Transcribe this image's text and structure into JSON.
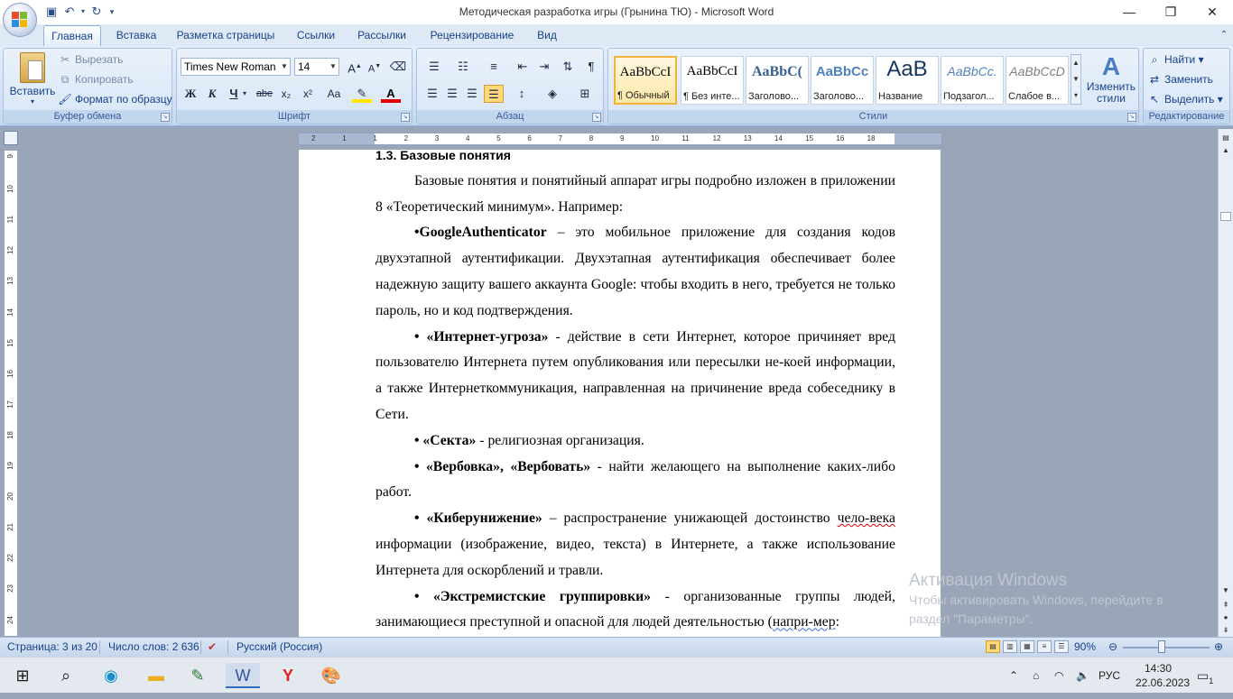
{
  "window": {
    "title": "Методическая разработка игры (Грынина ТЮ) - Microsoft Word"
  },
  "qat": {
    "icons": [
      "save-icon",
      "undo-icon",
      "redo-icon",
      "customize-icon"
    ]
  },
  "tabs": [
    "Главная",
    "Вставка",
    "Разметка страницы",
    "Ссылки",
    "Рассылки",
    "Рецензирование",
    "Вид"
  ],
  "clipboard": {
    "paste": "Вставить",
    "cut": "Вырезать",
    "copy": "Копировать",
    "format": "Формат по образцу",
    "label": "Буфер обмена"
  },
  "font": {
    "name": "Times New Roman",
    "size": "14",
    "label": "Шрифт",
    "bold": "Ж",
    "italic": "К",
    "underline": "Ч",
    "strike": "abe",
    "sub": "x₂",
    "sup": "x²",
    "case": "Aa"
  },
  "paragraph": {
    "label": "Абзац"
  },
  "styles": {
    "label": "Стили",
    "change": "Изменить стили",
    "items": [
      {
        "sample": "AaBbCcI",
        "name": "¶ Обычный"
      },
      {
        "sample": "AaBbCcI",
        "name": "¶ Без инте..."
      },
      {
        "sample": "AaBbC(",
        "name": "Заголово..."
      },
      {
        "sample": "AaBbCc",
        "name": "Заголово..."
      },
      {
        "sample": "AaB",
        "name": "Название"
      },
      {
        "sample": "AaBbCc.",
        "name": "Подзагол..."
      },
      {
        "sample": "AaBbCcD",
        "name": "Слабое в..."
      }
    ]
  },
  "editing": {
    "find": "Найти",
    "replace": "Заменить",
    "select": "Выделить",
    "label": "Редактирование"
  },
  "ruler": {
    "h": [
      "2",
      "1",
      "1",
      "2",
      "3",
      "4",
      "5",
      "6",
      "7",
      "8",
      "9",
      "10",
      "11",
      "12",
      "13",
      "14",
      "15",
      "16",
      "18"
    ],
    "v": [
      "9",
      "10",
      "11",
      "12",
      "13",
      "14",
      "15",
      "16",
      "17",
      "18",
      "19",
      "20",
      "21",
      "22",
      "23",
      "24"
    ]
  },
  "doc": {
    "heading": "1.3.    Базовые понятия",
    "p1": "Базовые понятия и понятийный аппарат игры подробно изложен в приложении 8 «Теоретический минимум». Например:",
    "p2b": "•GoogleAuthenticator",
    "p2": " – это мобильное приложение для создания кодов двухэтапной аутентификации. Двухэтапная аутентификация обеспечивает более надежную защиту вашего аккаунта Google: чтобы входить в него, требуется не только пароль, но и код подтверждения.",
    "p3b": "• «Интернет-угроза»",
    "p3": " - действие в сети Интернет, которое причиняет вред пользователю Интернета путем опубликования или пересылки не-коей информации, а также Интернеткоммуникация, направленная на причинение вреда собеседнику в Сети.",
    "p4b": "• «Секта»",
    "p4": " - религиозная организация.",
    "p5b": "• «Вербовка», «Вербовать»",
    "p5": " - найти желающего на выполнение каких-либо работ.",
    "p6b": "• «Киберунижение»",
    "p6a": " – распространение унижающей достоинство ",
    "p6s": "чело-века",
    "p6c": " информации (изображение, видео, текста) в Интернете, а также использование Интернета для оскорблений и травли.",
    "p7b": "• «Экстремистские группировки»",
    "p7a": " - организованные группы людей, занимающиеся преступной и опасной для людей деятельностью (",
    "p7s": "напри-мер",
    "p7c": ":"
  },
  "watermark": {
    "line1": "Активация Windows",
    "line2": "Чтобы активировать Windows, перейдите в",
    "line3": "раздел \"Параметры\"."
  },
  "status": {
    "page": "Страница: 3 из 20",
    "words": "Число слов: 2 636",
    "lang": "Русский (Россия)",
    "zoom": "90%"
  },
  "taskbar": {
    "lang": "РУС",
    "time": "14:30",
    "date": "22.06.2023",
    "notif": "1"
  }
}
